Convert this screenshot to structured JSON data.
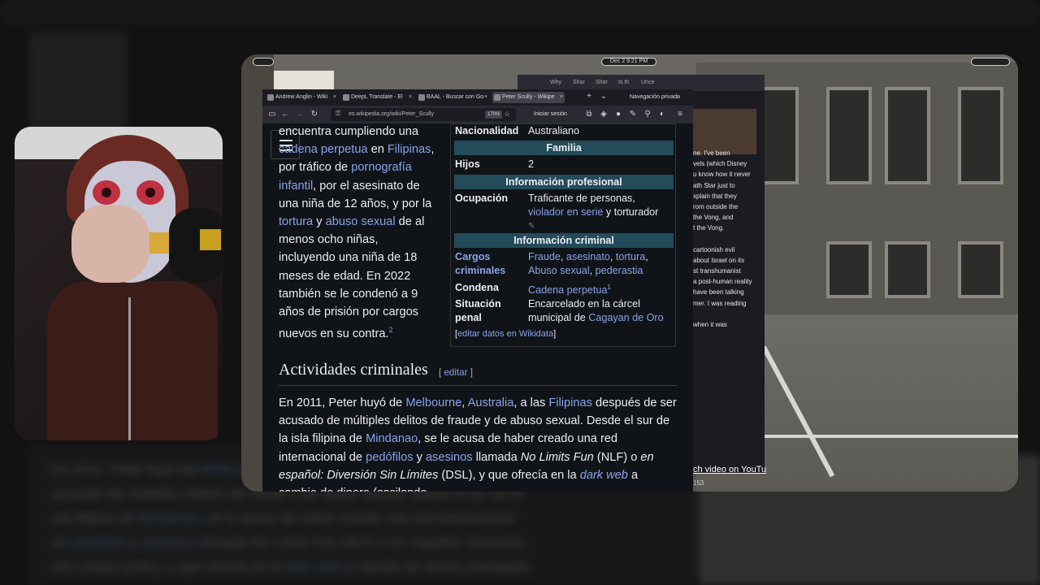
{
  "background": {
    "lines": [
      [
        "En 2011, Peter huyó de ",
        "Melbourne",
        ", ",
        "Australia",
        ", a las ",
        "Filipinas",
        " después de ser"
      ],
      [
        "acusado de múltiples delitos de fraude y de abuso sexual. Desde el sur de la"
      ],
      [
        "isla filipina de ",
        "Mindanao",
        ", se le acusa de haber creado una red internacional"
      ],
      [
        "de ",
        "pedófilos",
        " y ",
        "asesinos",
        " llamada No Limits Fun (NLF) o en español: Diversión"
      ],
      [
        "Sin Límites (DSL), y que ofrecía en la ",
        "dark web",
        " a cambio de dinero (oscilando"
      ]
    ]
  },
  "system": {
    "clock": "Dec 2   9:21 PM"
  },
  "back_browser": {
    "tabs": [
      "Why",
      "Shar",
      "Shar",
      "Is th",
      "Unce"
    ],
    "private_label": "Navegación privada",
    "text_lines": [
      "ne. I've been",
      "vels (which Disney",
      "u know how it never",
      "ath Star just to",
      "xplain that they",
      "rom outside the",
      "the Vong, and",
      "t the Vong.",
      "",
      "cartoonish evil",
      "about Israel on its",
      "st transhumanist",
      "a post-human reality",
      "have been talking",
      "mer. I was reading",
      "",
      "when it was"
    ],
    "video_link": "ch video on YouTu",
    "count": "153"
  },
  "browser": {
    "tabs": [
      {
        "label": "Andrew Anglin - Wiki"
      },
      {
        "label": "DeepL Translate - El"
      },
      {
        "label": "BAAL - Buscar con Go"
      },
      {
        "label": "Peter Scully - Wikipe"
      }
    ],
    "url": "es.wikipedia.org/wiki/Peter_Scully",
    "zoom": "170%",
    "signin": "Iniciar sesión"
  },
  "article": {
    "para1": [
      {
        "t": "encuentra cumpliendo una "
      },
      {
        "t": "cadena perpetua",
        "l": true
      },
      {
        "t": " en "
      },
      {
        "t": "Filipinas",
        "l": true
      },
      {
        "t": ", por tráfico de "
      },
      {
        "t": "pornografía infantil",
        "l": true
      },
      {
        "t": ", por el asesinato de una niña de 12 años, y por la "
      },
      {
        "t": "tortura",
        "l": true
      },
      {
        "t": " y "
      },
      {
        "t": "abuso sexual",
        "l": true
      },
      {
        "t": " de al menos ocho niñas, incluyendo una niña de 18 meses de edad. En 2022 también se le condenó a 9 años de prisión por cargos nuevos en su contra."
      }
    ],
    "para1_ref": "2",
    "heading": "Actividades criminales",
    "edit_label": "editar",
    "para2": [
      {
        "t": "En 2011, Peter huyó de "
      },
      {
        "t": "Melbourne",
        "l": true
      },
      {
        "t": ", "
      },
      {
        "t": "Australia",
        "l": true
      },
      {
        "t": ", a las "
      },
      {
        "t": "Filipinas",
        "l": true
      },
      {
        "t": " después de ser acusado de múltiples delitos de fraude y de abuso sexual. Desde el sur de la isla filipina de "
      },
      {
        "t": "Mindanao",
        "l": true
      },
      {
        "t": ", se le acusa de haber creado una red internacional de "
      },
      {
        "t": "pedófilos",
        "l": true
      },
      {
        "t": " y "
      },
      {
        "t": "asesinos",
        "l": true
      },
      {
        "t": " llamada "
      },
      {
        "t": "No Limits Fun",
        "i": true
      },
      {
        "t": " (NLF) o "
      },
      {
        "t": "en español: Diversión Sin Límites",
        "i": true
      },
      {
        "t": " (DSL), y que ofrecía en la "
      },
      {
        "t": "dark web",
        "l": true,
        "i": true
      },
      {
        "t": " a cambio de dinero (oscilando"
      }
    ]
  },
  "infobox": {
    "nacionalidad_key": "Nacionalidad",
    "nacionalidad_val": "Australiano",
    "familia_head": "Familia",
    "hijos_key": "Hijos",
    "hijos_val": "2",
    "profesional_head": "Información profesional",
    "ocupacion_key": "Ocupación",
    "ocupacion_val1": "Traficante de personas,",
    "ocupacion_link": "violador en serie",
    "ocupacion_val2": " y torturador",
    "criminal_head": "Información criminal",
    "cargos_key": "Cargos criminales",
    "cargos_links": [
      "Fraude",
      "asesinato",
      "tortura",
      "Abuso sexual",
      "pederastia"
    ],
    "condena_key": "Condena",
    "condena_val": "Cadena perpetua",
    "condena_ref": "1",
    "situacion_key": "Situación penal",
    "situacion_val": "Encarcelado en la cárcel municipal de ",
    "situacion_link": "Cagayan de Oro",
    "footer_link": "editar datos en Wikidata"
  },
  "colors": {
    "link": "#88a3e8",
    "infobox_header": "#234b5a",
    "page_bg": "#101418"
  }
}
